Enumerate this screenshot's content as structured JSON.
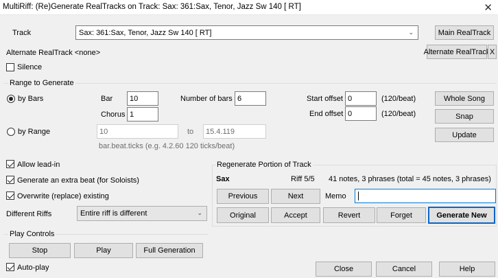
{
  "window": {
    "title": "MultiRiff: (Re)Generate RealTracks on Track: Sax: 361:Sax, Tenor, Jazz Sw 140 [ RT]",
    "close_glyph": "✕"
  },
  "track": {
    "label": "Track",
    "value": "Sax: 361:Sax, Tenor, Jazz Sw 140 [ RT]",
    "main_btn": "Main RealTrack",
    "alt_label": "Alternate RealTrack <none>",
    "alt_btn": "Alternate RealTrack",
    "alt_clear": "X",
    "silence": "Silence"
  },
  "range": {
    "group_title": "Range to Generate",
    "by_bars": "by Bars",
    "bar_label": "Bar",
    "bar_value": "10",
    "bars_count_label": "Number of bars",
    "bars_count_value": "6",
    "chorus_label": "Chorus",
    "chorus_value": "1",
    "start_offset_label": "Start offset",
    "start_offset_value": "0",
    "end_offset_label": "End offset",
    "end_offset_value": "0",
    "unit": "(120/beat)",
    "by_range": "by Range",
    "range_from": "10",
    "range_to_label": "to",
    "range_to": "15.4.119",
    "hint": "bar.beat.ticks (e.g. 4.2.60  120 ticks/beat)",
    "whole_song": "Whole Song",
    "snap": "Snap",
    "update": "Update"
  },
  "options": {
    "allow_leadin": "Allow lead-in",
    "extra_beat": "Generate an extra beat (for Soloists)",
    "overwrite": "Overwrite (replace) existing",
    "diff_riffs_label": "Different Riffs",
    "diff_riffs_value": "Entire riff is different"
  },
  "regen": {
    "group_title": "Regenerate Portion of Track",
    "instrument": "Sax",
    "riff": "Riff 5/5",
    "summary": "41 notes, 3 phrases (total = 45 notes, 3  phrases)",
    "previous": "Previous",
    "next": "Next",
    "memo_label": "Memo",
    "memo_value": "",
    "original": "Original",
    "accept": "Accept",
    "revert": "Revert",
    "forget": "Forget",
    "generate_new": "Generate New"
  },
  "play": {
    "group_title": "Play Controls",
    "stop": "Stop",
    "play": "Play",
    "full_gen": "Full Generation",
    "autoplay": "Auto-play"
  },
  "footer": {
    "close": "Close",
    "cancel": "Cancel",
    "help": "Help"
  },
  "colors": {
    "default_button_border": "#0a64c8",
    "focus_border": "#0078d7"
  }
}
